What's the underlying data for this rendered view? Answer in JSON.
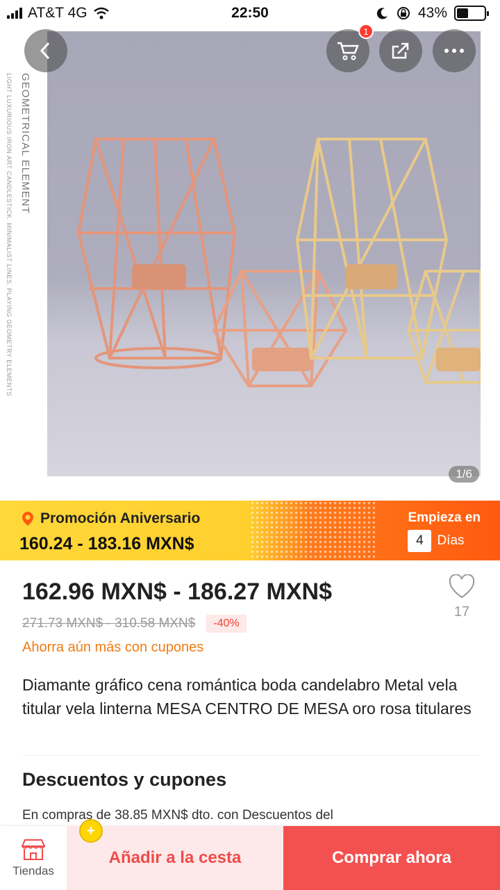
{
  "status_bar": {
    "carrier": "AT&T 4G",
    "time": "22:50",
    "battery": "43%",
    "battery_level": 0.43
  },
  "gallery": {
    "counter": "1/6",
    "cart_count": "1",
    "side_text_1": "GEOMETRICAL ELEMENT",
    "side_text_2": "LIGHT LUXURIOUS IRON ART CANDLESTICK. MINIMALIST LINES. PLAYING GEOMETRY ELEMENTS"
  },
  "promo": {
    "title": "Promoción Aniversario",
    "price_range": "160.24 - 183.16 MXN$",
    "starts_label": "Empieza en",
    "days_value": "4",
    "days_label": "Días"
  },
  "product": {
    "price": "162.96 MXN$ - 186.27 MXN$",
    "original_price": "271.73 MXN$ - 310.58 MXN$",
    "discount": "-40%",
    "coupon_link": "Ahorra aún más con cupones",
    "wishlist_count": "17",
    "title": "Diamante gráfico cena romántica boda candelabro Metal vela titular vela linterna MESA CENTRO DE MESA oro rosa titulares"
  },
  "discounts": {
    "heading": "Descuentos y cupones",
    "text": "En compras de 38.85 MXN$ dto. con Descuentos del"
  },
  "bottom_bar": {
    "store_label": "Tiendas",
    "add_to_cart": "Añadir a la cesta",
    "buy_now": "Comprar ahora"
  },
  "colors": {
    "accent_orange": "#f07b12",
    "buy_red": "#f35050",
    "promo_yellow": "#ffd83a",
    "promo_orange": "#ff5a10"
  }
}
